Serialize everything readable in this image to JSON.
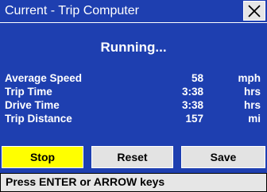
{
  "window": {
    "title": "Current - Trip Computer"
  },
  "status": "Running...",
  "stats": [
    {
      "label": "Average Speed",
      "value": "58",
      "unit": "mph"
    },
    {
      "label": "Trip Time",
      "value": "3:38",
      "unit": "hrs"
    },
    {
      "label": "Drive Time",
      "value": "3:38",
      "unit": "hrs"
    },
    {
      "label": "Trip Distance",
      "value": "157",
      "unit": "mi"
    }
  ],
  "buttons": {
    "stop": "Stop",
    "reset": "Reset",
    "save": "Save"
  },
  "hint": "Press ENTER or ARROW keys",
  "colors": {
    "background": "#1e3fb0",
    "primary_button": "#ffff00",
    "button": "#e3e3e3"
  }
}
